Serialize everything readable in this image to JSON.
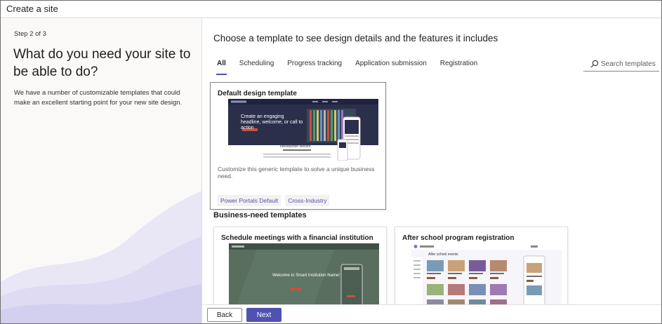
{
  "window": {
    "title": "Create a site"
  },
  "left": {
    "step": "Step 2 of 3",
    "question": "What do you need your site to be able to do?",
    "description": "We have a number of customizable templates that could make an excellent starting point for your new site design."
  },
  "main": {
    "heading": "Choose a template to see design details and the features it includes",
    "tabs": [
      {
        "label": "All",
        "active": true
      },
      {
        "label": "Scheduling"
      },
      {
        "label": "Progress tracking"
      },
      {
        "label": "Application submission"
      },
      {
        "label": "Registration"
      }
    ],
    "search": {
      "placeholder": "Search templates",
      "icon": "search-icon"
    },
    "default_template": {
      "title": "Default design template",
      "description": "Customize this generic template to solve a unique business need.",
      "preview_headline": "Create an engaging headline, welcome, or call to action",
      "preview_section": "Introduction section",
      "tags": [
        "Power Portals Default",
        "Cross-Industry"
      ]
    },
    "business_label": "Business-need templates",
    "business_templates": [
      {
        "title": "Schedule meetings with a financial institution",
        "preview_text": "Welcome to Smart Institution Name!"
      },
      {
        "title": "After school program registration",
        "preview_text": "After school events"
      }
    ]
  },
  "footer": {
    "back": "Back",
    "next": "Next"
  },
  "colors": {
    "accent": "#4f52b2",
    "hero_dark": "#2b2f4a",
    "green_hero": "#596e5f",
    "cta_orange": "#c8513b"
  }
}
